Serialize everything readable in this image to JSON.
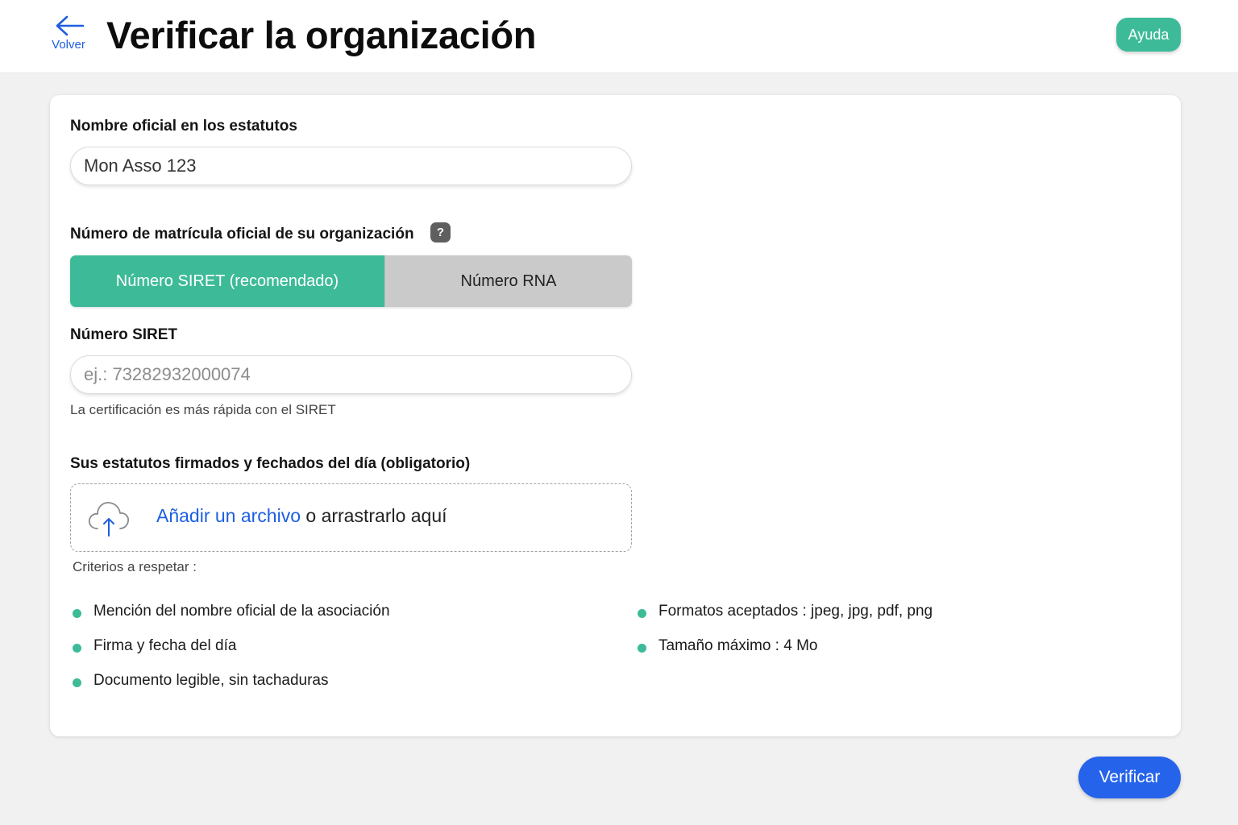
{
  "header": {
    "back_label": "Volver",
    "title": "Verificar la organización",
    "help_label": "Ayuda"
  },
  "form": {
    "official_name": {
      "label": "Nombre oficial en los estatutos",
      "value": "Mon Asso 123"
    },
    "registration": {
      "label": "Número de matrícula oficial de su organización",
      "help_icon": "?",
      "options": [
        {
          "label": "Número SIRET (recomendado)",
          "selected": true
        },
        {
          "label": "Número RNA",
          "selected": false
        }
      ]
    },
    "siret": {
      "label": "Número SIRET",
      "placeholder": "ej.: 73282932000074",
      "hint": "La certificación es más rápida con el SIRET"
    },
    "statutes": {
      "label": "Sus estatutos firmados y fechados del día (obligatorio)",
      "upload_link": "Añadir un archivo",
      "upload_rest": " o arrastrarlo aquí",
      "icon": "cloud-upload-icon"
    },
    "criteria": {
      "title": "Criterios a respetar :",
      "left": [
        "Mención del nombre oficial de la asociación",
        "Firma y fecha del día",
        "Documento legible, sin tachaduras"
      ],
      "right": [
        "Formatos aceptados : jpeg, jpg, pdf, png",
        "Tamaño máximo : 4 Mo"
      ]
    }
  },
  "footer": {
    "verify_label": "Verificar"
  },
  "colors": {
    "accent_green": "#3dbb98",
    "link_blue": "#1d5fe0",
    "primary_blue": "#2563eb",
    "background": "#f1f1f1"
  }
}
